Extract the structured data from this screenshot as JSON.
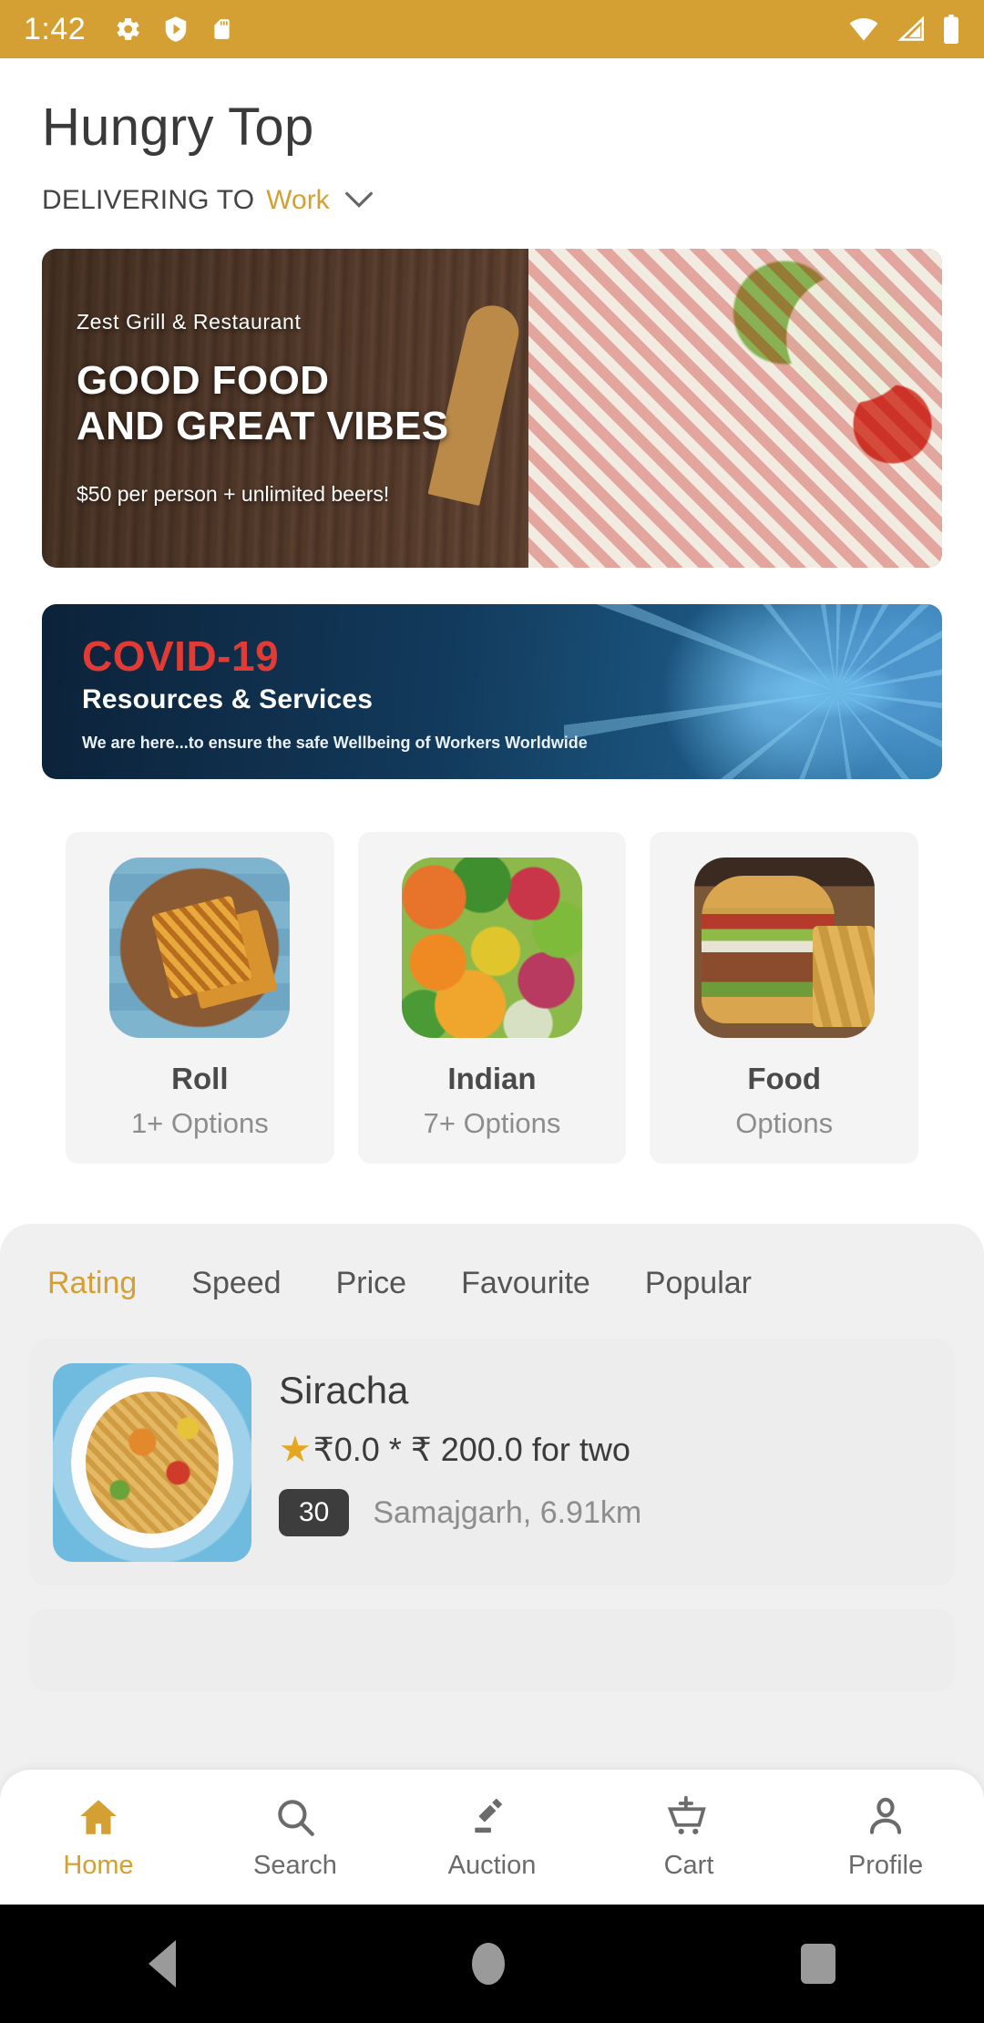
{
  "theme": {
    "accent": "#D5A033",
    "status_bar_bg": "#D5A033",
    "text_dark": "#3a3a3a",
    "text_muted": "#8d8d8d"
  },
  "status_bar": {
    "time": "1:42",
    "left_icons": [
      "gear-icon",
      "play-protect-icon",
      "sd-card-icon"
    ],
    "right_icons": [
      "wifi-icon",
      "signal-icon",
      "battery-icon"
    ]
  },
  "header": {
    "title": "Hungry Top",
    "delivering_label": "DELIVERING TO",
    "delivering_value": "Work",
    "chevron": "⌄"
  },
  "banners": [
    {
      "name": "promo-banner",
      "kicker": "Zest Grill & Restaurant",
      "headline_line1": "GOOD FOOD",
      "headline_line2": "AND GREAT VIBES",
      "subtext": "$50 per person + unlimited beers!"
    },
    {
      "name": "covid-banner",
      "title": "COVID-19",
      "subtitle": "Resources & Services",
      "note": "We are here...to ensure the safe Wellbeing of Workers Worldwide",
      "title_color": "#e23b35"
    }
  ],
  "categories": [
    {
      "name": "Roll",
      "options": "1+ Options",
      "image": "grilled-sandwich-image"
    },
    {
      "name": "Indian",
      "options": "7+ Options",
      "image": "vegetables-image"
    },
    {
      "name": "Food",
      "options": "Options",
      "image": "burger-fries-image"
    }
  ],
  "sort_tabs": [
    {
      "label": "Rating",
      "active": true
    },
    {
      "label": "Speed",
      "active": false
    },
    {
      "label": "Price",
      "active": false
    },
    {
      "label": "Favourite",
      "active": false
    },
    {
      "label": "Popular",
      "active": false
    }
  ],
  "restaurants": [
    {
      "name": "Siracha",
      "star": "★",
      "rating_line": "₹0.0 * ₹ 200.0 for two",
      "badge": "30",
      "location": "Samajgarh, 6.91km",
      "image": "noodles-bowl-image"
    }
  ],
  "bottom_nav": [
    {
      "label": "Home",
      "icon": "home-icon",
      "active": true
    },
    {
      "label": "Search",
      "icon": "search-icon",
      "active": false
    },
    {
      "label": "Auction",
      "icon": "gavel-icon",
      "active": false
    },
    {
      "label": "Cart",
      "icon": "add-cart-icon",
      "active": false
    },
    {
      "label": "Profile",
      "icon": "person-icon",
      "active": false
    }
  ],
  "android_nav": {
    "back": "back-button",
    "home": "home-button",
    "recents": "recents-button"
  }
}
